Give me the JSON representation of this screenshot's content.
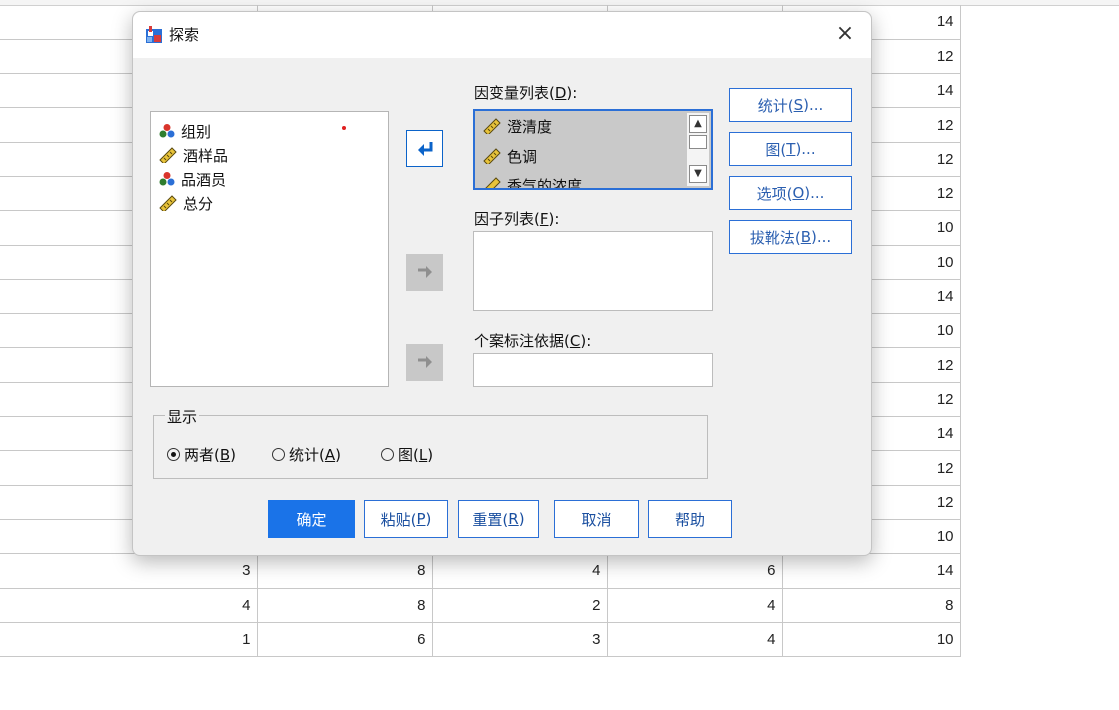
{
  "dialog": {
    "title": "探索",
    "close_symbol": "×",
    "source_variables": [
      {
        "label": "组别",
        "icon": "nominal-variable-icon"
      },
      {
        "label": "酒样品",
        "icon": "scale-ruler-icon"
      },
      {
        "label": "品酒员",
        "icon": "nominal-variable-icon"
      },
      {
        "label": "总分",
        "icon": "scale-ruler-icon"
      }
    ],
    "dependent_list": {
      "label_pre": "因变量列表(",
      "label_key": "D",
      "label_post": "):",
      "items": [
        {
          "label": "澄清度",
          "icon": "scale-ruler-icon"
        },
        {
          "label": "色调",
          "icon": "scale-ruler-icon"
        },
        {
          "label": "香气的浓度",
          "icon": "scale-ruler-icon"
        }
      ]
    },
    "factor_list": {
      "label_pre": "因子列表(",
      "label_key": "F",
      "label_post": "):"
    },
    "case_label": {
      "label_pre": "个案标注依据(",
      "label_key": "C",
      "label_post": "):"
    },
    "side_buttons": [
      {
        "pre": "统计(",
        "key": "S",
        "post": ")..."
      },
      {
        "pre": "图(",
        "key": "T",
        "post": ")..."
      },
      {
        "pre": "选项(",
        "key": "O",
        "post": ")..."
      },
      {
        "pre": "拔靴法(",
        "key": "B",
        "post": ")..."
      }
    ],
    "display": {
      "legend": "显示",
      "options": [
        {
          "pre": "两者(",
          "key": "B",
          "post": ")",
          "selected": true
        },
        {
          "pre": "统计(",
          "key": "A",
          "post": ")",
          "selected": false
        },
        {
          "pre": "图(",
          "key": "L",
          "post": ")",
          "selected": false
        }
      ]
    },
    "buttons": {
      "ok": "确定",
      "paste": {
        "pre": "粘贴(",
        "key": "P",
        "post": ")"
      },
      "reset": {
        "pre": "重置(",
        "key": "R",
        "post": ")"
      },
      "cancel": "取消",
      "help": "帮助"
    }
  },
  "spreadsheet": {
    "rows": [
      [
        "",
        "",
        "",
        "",
        "14"
      ],
      [
        "",
        "",
        "",
        "",
        "12"
      ],
      [
        "",
        "",
        "",
        "",
        "14"
      ],
      [
        "",
        "",
        "",
        "",
        "12"
      ],
      [
        "",
        "",
        "",
        "",
        "12"
      ],
      [
        "",
        "",
        "",
        "",
        "12"
      ],
      [
        "",
        "",
        "",
        "",
        "10"
      ],
      [
        "",
        "",
        "",
        "",
        "10"
      ],
      [
        "",
        "",
        "",
        "",
        "14"
      ],
      [
        "",
        "",
        "",
        "",
        "10"
      ],
      [
        "",
        "",
        "",
        "",
        "12"
      ],
      [
        "",
        "",
        "",
        "",
        "12"
      ],
      [
        "",
        "",
        "",
        "",
        "14"
      ],
      [
        "",
        "",
        "",
        "",
        "12"
      ],
      [
        "",
        "",
        "",
        "",
        "12"
      ],
      [
        "",
        "",
        "",
        "",
        "10"
      ],
      [
        "3",
        "8",
        "4",
        "6",
        "14"
      ],
      [
        "4",
        "8",
        "2",
        "4",
        "8"
      ],
      [
        "1",
        "6",
        "3",
        "4",
        "10"
      ]
    ]
  },
  "colors": {
    "accent": "#1a73e8",
    "selection_border": "#2b6fd6",
    "selected_bg": "#c9c9c9",
    "dialog_bg": "#f0f0f0"
  }
}
